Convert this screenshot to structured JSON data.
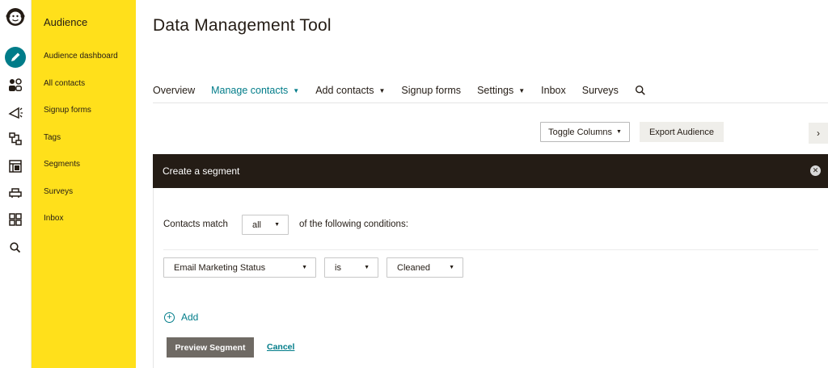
{
  "rail": {
    "icons": [
      "freddie-logo-icon",
      "create-pencil-icon",
      "audience-icon",
      "campaigns-icon",
      "automations-icon",
      "website-icon",
      "integrations-icon",
      "dashboard-grid-icon",
      "search-icon"
    ]
  },
  "sidebar": {
    "title": "Audience",
    "items": [
      {
        "label": "Audience dashboard"
      },
      {
        "label": "All contacts"
      },
      {
        "label": "Signup forms"
      },
      {
        "label": "Tags"
      },
      {
        "label": "Segments"
      },
      {
        "label": "Surveys"
      },
      {
        "label": "Inbox"
      }
    ]
  },
  "header": {
    "title": "Data Management Tool"
  },
  "nav": {
    "tabs": [
      {
        "label": "Overview",
        "dropdown": false,
        "active": false
      },
      {
        "label": "Manage contacts",
        "dropdown": true,
        "active": true
      },
      {
        "label": "Add contacts",
        "dropdown": true,
        "active": false
      },
      {
        "label": "Signup forms",
        "dropdown": false,
        "active": false
      },
      {
        "label": "Settings",
        "dropdown": true,
        "active": false
      },
      {
        "label": "Inbox",
        "dropdown": false,
        "active": false
      },
      {
        "label": "Surveys",
        "dropdown": false,
        "active": false
      }
    ],
    "search_icon": "search-icon"
  },
  "toolbar": {
    "toggle_columns": "Toggle Columns",
    "export_audience": "Export Audience",
    "scroll_right": "›"
  },
  "segment": {
    "header": "Create a segment",
    "contacts_match_label": "Contacts match",
    "match_value": "all",
    "conditions_label": "of the following conditions:",
    "condition": {
      "field": "Email Marketing Status",
      "operator": "is",
      "value": "Cleaned"
    },
    "add_label": "Add",
    "preview_button": "Preview Segment",
    "cancel_link": "Cancel"
  },
  "colors": {
    "accent_teal": "#007c89",
    "sidebar_yellow": "#ffe01b",
    "header_dark": "#241c15",
    "preview_button": "#6f6a64"
  }
}
